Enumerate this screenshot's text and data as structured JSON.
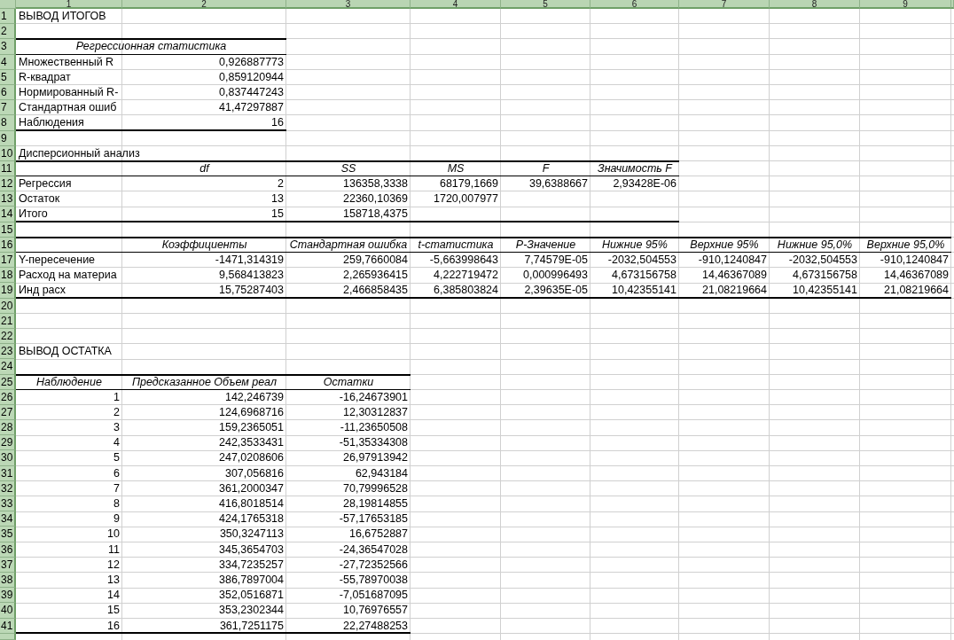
{
  "column_headers": [
    "1",
    "2",
    "3",
    "4",
    "5",
    "6",
    "7",
    "8",
    "9"
  ],
  "row_headers": [
    "1",
    "2",
    "3",
    "4",
    "5",
    "6",
    "7",
    "8",
    "9",
    "10",
    "11",
    "12",
    "13",
    "14",
    "15",
    "16",
    "17",
    "18",
    "19",
    "20",
    "21",
    "22",
    "23",
    "24",
    "25",
    "26",
    "27",
    "28",
    "29",
    "30",
    "31",
    "32",
    "33",
    "34",
    "35",
    "36",
    "37",
    "38",
    "39",
    "40",
    "41"
  ],
  "summary_title": "ВЫВОД ИТОГОВ",
  "regression_statistics": {
    "title": "Регрессионная статистика",
    "rows": [
      {
        "label": "Множественный R",
        "value": "0,926887773"
      },
      {
        "label": "R-квадрат",
        "value": "0,859120944"
      },
      {
        "label": "Нормированный R-",
        "value": "0,837447243"
      },
      {
        "label": "Стандартная ошиб",
        "value": "41,47297887"
      },
      {
        "label": "Наблюдения",
        "value": "16"
      }
    ]
  },
  "anova": {
    "title": "Дисперсионный анализ",
    "columns": [
      "df",
      "SS",
      "MS",
      "F",
      "Значимость F"
    ],
    "rows": [
      {
        "label": "Регрессия",
        "values": [
          "2",
          "136358,3338",
          "68179,1669",
          "39,6388667",
          "2,93428E-06"
        ]
      },
      {
        "label": "Остаток",
        "values": [
          "13",
          "22360,10369",
          "1720,007977"
        ]
      },
      {
        "label": "Итого",
        "values": [
          "15",
          "158718,4375"
        ]
      }
    ]
  },
  "coefficients": {
    "columns": [
      "Коэффициенты",
      "Стандартная ошибка",
      "t-статистика",
      "P-Значение",
      "Нижние 95%",
      "Верхние 95%",
      "Нижние 95,0%",
      "Верхние 95,0%"
    ],
    "rows": [
      {
        "label": "Y-пересечение",
        "values": [
          "-1471,314319",
          "259,7660084",
          "-5,663998643",
          "7,74579E-05",
          "-2032,504553",
          "-910,1240847",
          "-2032,504553",
          "-910,1240847"
        ]
      },
      {
        "label": "Расход на материа",
        "values": [
          "9,568413823",
          "2,265936415",
          "4,222719472",
          "0,000996493",
          "4,673156758",
          "14,46367089",
          "4,673156758",
          "14,46367089"
        ]
      },
      {
        "label": "Инд расх",
        "values": [
          "15,75287403",
          "2,466858435",
          "6,385803824",
          "2,39635E-05",
          "10,42355141",
          "21,08219664",
          "10,42355141",
          "21,08219664"
        ]
      }
    ]
  },
  "residual_output": {
    "title": "ВЫВОД ОСТАТКА",
    "columns": [
      "Наблюдение",
      "Предсказанное Объем реал",
      "Остатки"
    ],
    "rows": [
      {
        "observation": "1",
        "predicted": "142,246739",
        "residual": "-16,24673901"
      },
      {
        "observation": "2",
        "predicted": "124,6968716",
        "residual": "12,30312837"
      },
      {
        "observation": "3",
        "predicted": "159,2365051",
        "residual": "-11,23650508"
      },
      {
        "observation": "4",
        "predicted": "242,3533431",
        "residual": "-51,35334308"
      },
      {
        "observation": "5",
        "predicted": "247,0208606",
        "residual": "26,97913942"
      },
      {
        "observation": "6",
        "predicted": "307,056816",
        "residual": "62,943184"
      },
      {
        "observation": "7",
        "predicted": "361,2000347",
        "residual": "70,79996528"
      },
      {
        "observation": "8",
        "predicted": "416,8018514",
        "residual": "28,19814855"
      },
      {
        "observation": "9",
        "predicted": "424,1765318",
        "residual": "-57,17653185"
      },
      {
        "observation": "10",
        "predicted": "350,3247113",
        "residual": "16,6752887"
      },
      {
        "observation": "11",
        "predicted": "345,3654703",
        "residual": "-24,36547028"
      },
      {
        "observation": "12",
        "predicted": "334,7235257",
        "residual": "-27,72352566"
      },
      {
        "observation": "13",
        "predicted": "386,7897004",
        "residual": "-55,78970038"
      },
      {
        "observation": "14",
        "predicted": "352,0516871",
        "residual": "-7,051687095"
      },
      {
        "observation": "15",
        "predicted": "353,2302344",
        "residual": "10,76976557"
      },
      {
        "observation": "16",
        "predicted": "361,7251175",
        "residual": "22,27488253"
      }
    ]
  }
}
